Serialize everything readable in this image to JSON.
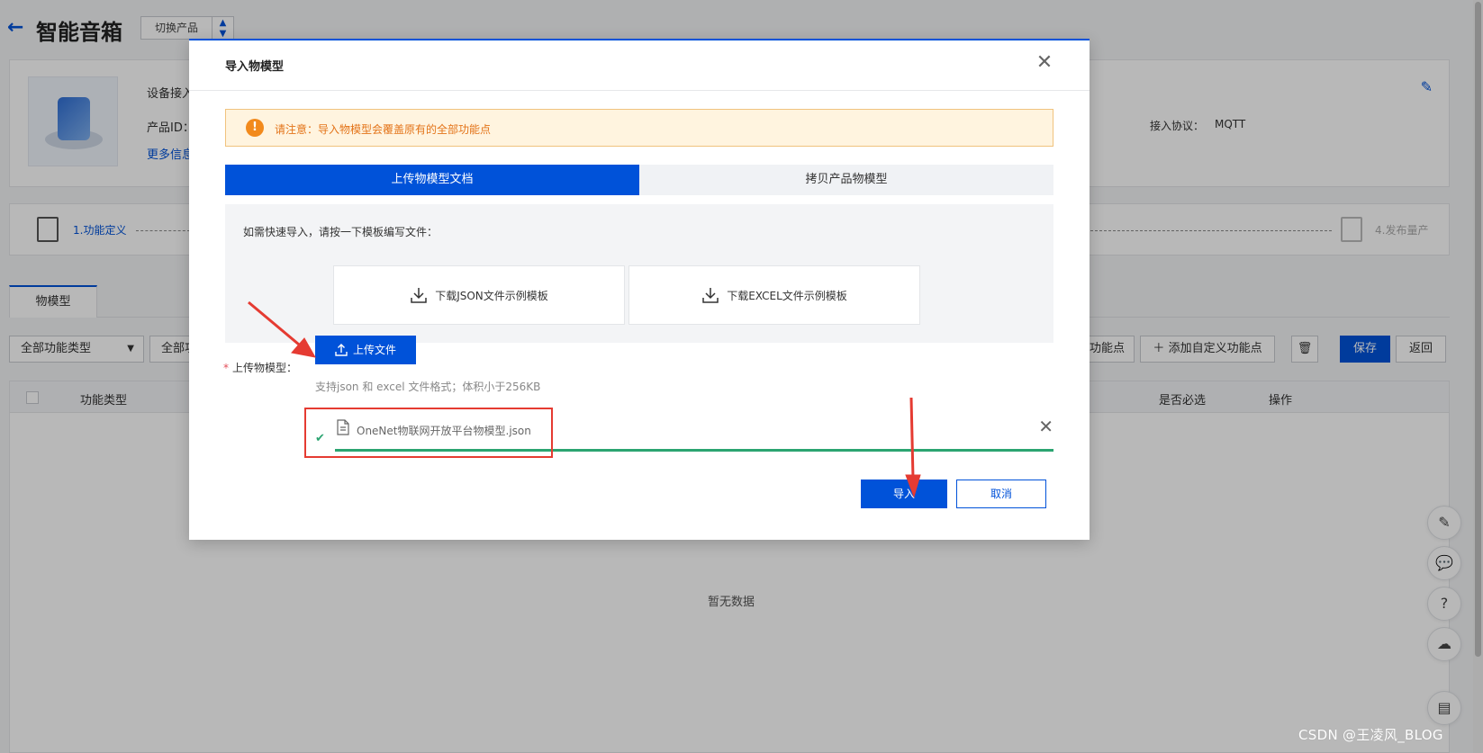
{
  "header": {
    "title": "智能音箱",
    "switch_label": "切换产品"
  },
  "product_card": {
    "access_label": "设备接入",
    "product_id_label": "产品ID：",
    "more_info": "更多信息",
    "protocol_label": "接入协议：",
    "protocol_value": "MQTT"
  },
  "steps": {
    "step1": "1.功能定义",
    "step4": "4.发布量产"
  },
  "tabs": [
    {
      "label": "物模型"
    }
  ],
  "filters": {
    "type_select": "全部功能类型",
    "second_select": "全部功"
  },
  "toolbar": {
    "add_std_label": "功能点",
    "add_custom_label": "添加自定义功能点",
    "save_label": "保存",
    "back_label": "返回"
  },
  "table": {
    "columns": [
      "功能类型",
      "是否必选",
      "操作"
    ],
    "empty_text": "暂无数据"
  },
  "modal": {
    "title": "导入物模型",
    "notice": "请注意：导入物模型会覆盖原有的全部功能点",
    "tabs": [
      {
        "label": "上传物模型文档",
        "active": true
      },
      {
        "label": "拷贝产品物模型",
        "active": false
      }
    ],
    "template_hint": "如需快速导入，请按一下模板编写文件：",
    "download_json": "下载JSON文件示例模板",
    "download_excel": "下载EXCEL文件示例模板",
    "upload_label": "上传物模型：",
    "upload_button": "上传文件",
    "support_tip": "支持json 和 excel 文件格式；体积小于256KB",
    "file_name": "OneNet物联网开放平台物模型.json",
    "file_progress": 1.0,
    "import_button": "导入",
    "cancel_button": "取消"
  },
  "watermark": "CSDN @王凌风_BLOG",
  "colors": {
    "primary": "#0052d9",
    "warning": "#e37318",
    "success": "#2ba471",
    "annotation": "#e53b32"
  },
  "icons": [
    "back-arrow-icon",
    "chevron-updown-icon",
    "edit-icon",
    "close-icon",
    "warning-icon",
    "download-icon",
    "upload-icon",
    "check-icon",
    "file-icon",
    "remove-icon",
    "feedback-icon",
    "chat-icon",
    "help-icon",
    "cloud-icon",
    "collapse-icon"
  ]
}
